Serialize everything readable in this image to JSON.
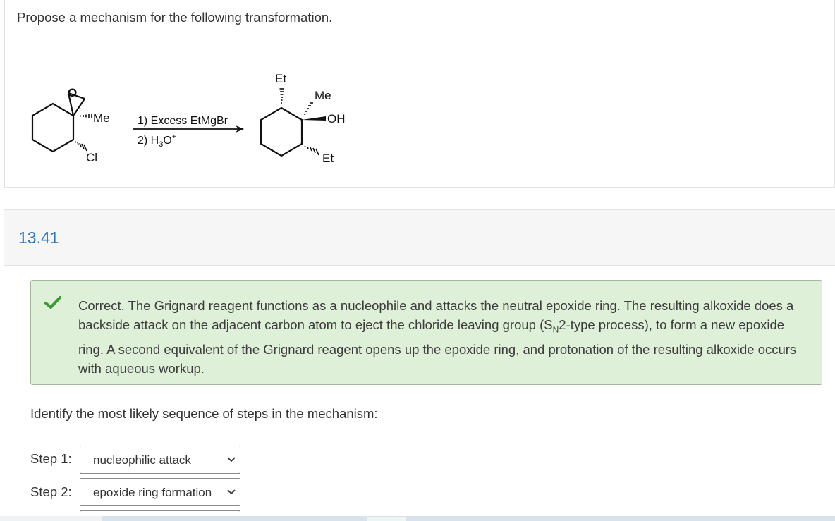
{
  "prompt": {
    "text": "Propose a mechanism for the following transformation."
  },
  "scheme": {
    "reactant": {
      "oxygen": "O",
      "methyl": "Me",
      "chloro": "Cl"
    },
    "reagents": {
      "step1": "1) Excess EtMgBr",
      "step2_prefix": "2) H",
      "step2_sub": "3",
      "step2_mid": "O",
      "step2_sup": "+"
    },
    "product": {
      "ethyl_top": "Et",
      "methyl": "Me",
      "hydroxyl": "OH",
      "ethyl_bottom": "Et"
    }
  },
  "section": {
    "number": "13.41"
  },
  "feedback": {
    "status": "correct",
    "icon": "check-icon",
    "text_part1": "Correct. The Grignard reagent functions as a nucleophile and attacks the neutral epoxide ring. The resulting alkoxide does a backside attack on the adjacent carbon atom to eject the chloride leaving group (S",
    "text_sub": "N",
    "text_part2": "2-type process), to form a new epoxide ring. A second equivalent of the Grignard reagent opens up the epoxide ring, and protonation of the resulting alkoxide occurs with aqueous workup.",
    "colors": {
      "background": "#dff0d8",
      "border": "#a6b79d",
      "check": "#3a9a33"
    }
  },
  "question": {
    "text": "Identify the most likely sequence of steps in the mechanism:",
    "steps": [
      {
        "label": "Step 1:",
        "selected": "nucleophilic attack"
      },
      {
        "label": "Step 2:",
        "selected": "epoxide ring formation"
      }
    ]
  },
  "colors": {
    "accent": "#2a76ba"
  }
}
